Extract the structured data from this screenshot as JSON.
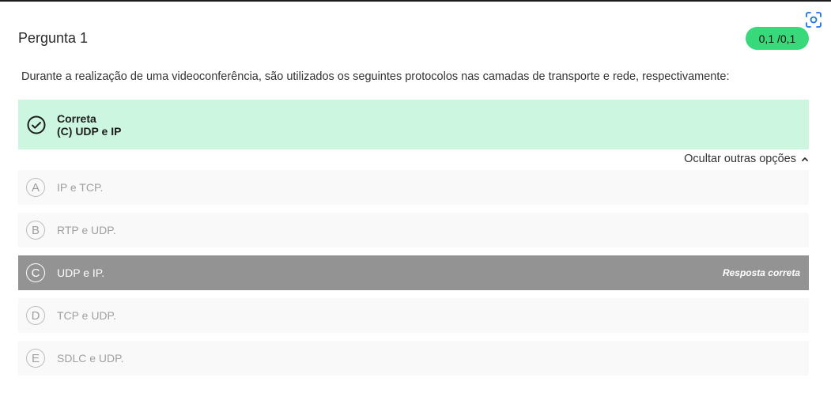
{
  "question": {
    "title": "Pergunta 1",
    "score": "0,1 /0,1",
    "prompt": "Durante a realização de uma videoconferência, são utilizados os seguintes protocolos nas camadas de transporte e rede, respectivamente:"
  },
  "result": {
    "status": "Correta",
    "answer": "(C) UDP e IP"
  },
  "toggle_label": "Ocultar outras opções",
  "options": [
    {
      "letter": "A",
      "text": "IP e TCP."
    },
    {
      "letter": "B",
      "text": "RTP e UDP."
    },
    {
      "letter": "C",
      "text": "UDP e IP.",
      "tag": "Resposta correta"
    },
    {
      "letter": "D",
      "text": "TCP e UDP."
    },
    {
      "letter": "E",
      "text": "SDLC e UDP."
    }
  ],
  "colors": {
    "score_badge": "#37d97a",
    "result_bg": "#ccf6df",
    "correct_option_bg": "#939393",
    "focus_icon": "#1a73e8"
  },
  "icons": {
    "top_right": "focus-scan-icon",
    "result": "check-circle-icon",
    "toggle": "chevron-up-icon"
  }
}
